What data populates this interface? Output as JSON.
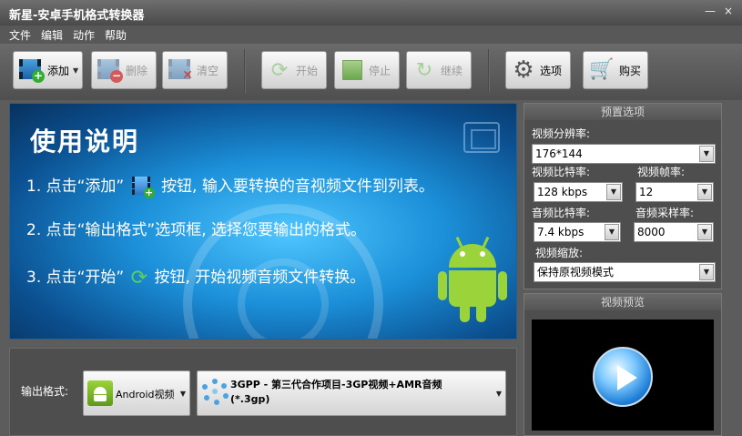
{
  "window": {
    "title": "新星-安卓手机格式转换器",
    "minimize": "—",
    "close": "×"
  },
  "menu": [
    "文件",
    "编辑",
    "动作",
    "帮助"
  ],
  "toolbar": {
    "add": "添加",
    "delete": "删除",
    "clear": "清空",
    "start": "开始",
    "stop": "停止",
    "continue": "继续",
    "options": "选项",
    "buy": "购买"
  },
  "banner": {
    "heading": "使用说明",
    "step1_a": "1. 点击“添加”",
    "step1_b": "按钮, 输入要转换的音视频文件到列表。",
    "step2": "2. 点击“输出格式”选项框, 选择您要输出的格式。",
    "step3_a": "3. 点击“开始”",
    "step3_b": "按钮, 开始视频音频文件转换。"
  },
  "presets": {
    "title": "预置选项",
    "resolution_label": "视频分辨率:",
    "resolution": "176*144",
    "video_bitrate_label": "视频比特率:",
    "video_bitrate": "128 kbps",
    "frame_rate_label": "视频帧率:",
    "frame_rate": "12",
    "audio_bitrate_label": "音频比特率:",
    "audio_bitrate": "7.4 kbps",
    "sample_rate_label": "音频采样率:",
    "sample_rate": "8000",
    "scaling_label": "视频缩放:",
    "scaling": "保持原视频模式"
  },
  "preview": {
    "title": "视频预览"
  },
  "output": {
    "label": "输出格式:",
    "device": "Android视频",
    "format_line1": "3GPP -  第三代合作项目-3GP视频+AMR音频",
    "format_line2": "(*.3gp)"
  },
  "colors": {
    "accent_blue": "#1b8fd8",
    "android_green": "#9bd33a",
    "chrome_gray": "#5c5c5c"
  }
}
